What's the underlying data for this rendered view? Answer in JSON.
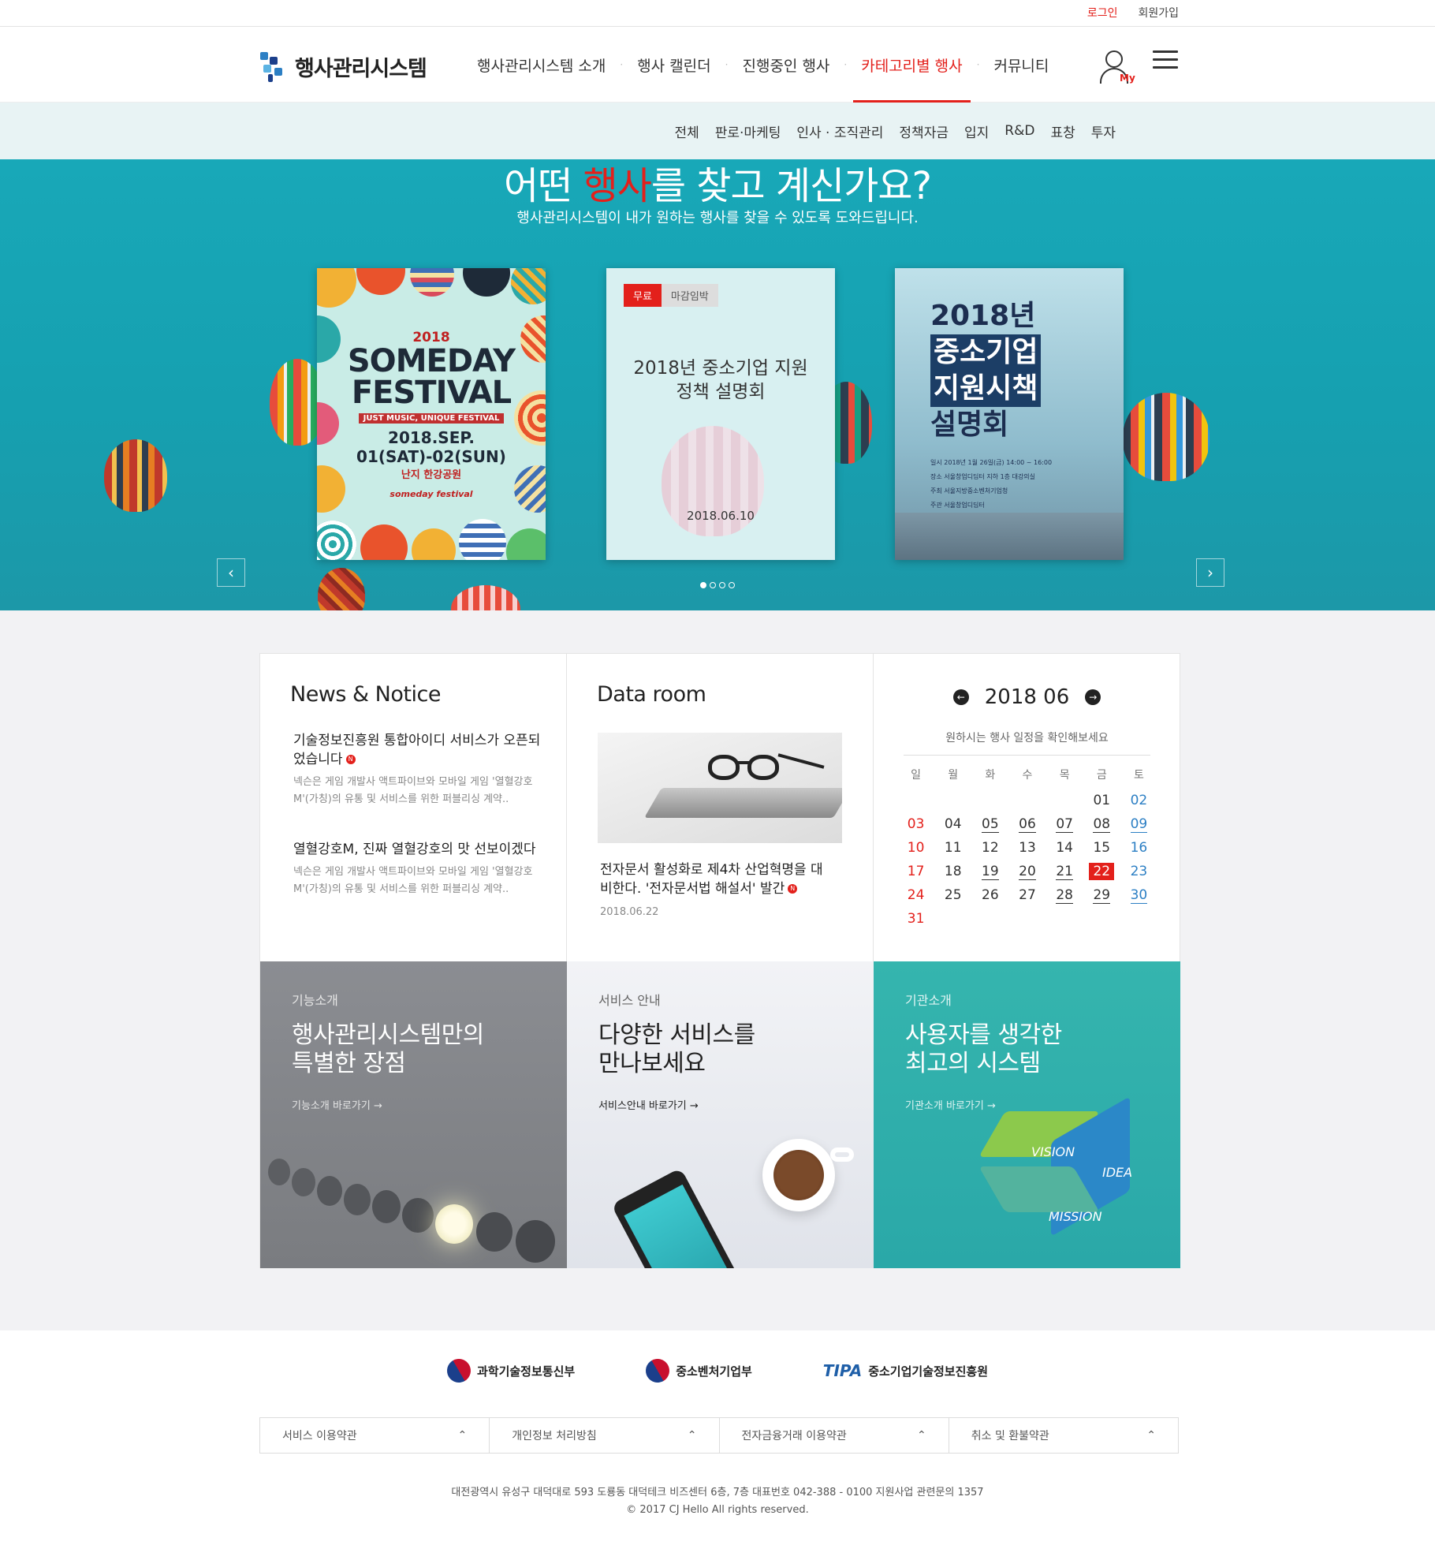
{
  "util": {
    "login": "로그인",
    "join": "회원가입"
  },
  "header": {
    "logo": "행사관리시스템",
    "nav": [
      "행사관리시스템 소개",
      "행사 캘린더",
      "진행중인 행사",
      "카테고리별 행사",
      "커뮤니티"
    ],
    "my_label": "My"
  },
  "subnav": [
    "전체",
    "판로·마케팅",
    "인사 · 조직관리",
    "정책자금",
    "입지",
    "R&D",
    "표창",
    "투자"
  ],
  "hero": {
    "title_pre": "어떤 ",
    "title_hl": "행사",
    "title_post": "를 찾고 계신가요?",
    "subtitle": "행사관리시스템이 내가 원하는 행사를 찾을 수 있도록 도와드립니다.",
    "card1": {
      "year": "2018",
      "line1": "SOMEDAY",
      "line2": "FESTIVAL",
      "tag": "JUST MUSIC, UNIQUE FESTIVAL",
      "date1": "2018.SEP.",
      "date2": "01(SAT)-02(SUN)",
      "place": "난지 한강공원",
      "brand": "someday festival"
    },
    "card2": {
      "badge_free": "무료",
      "badge_deadline": "마감임박",
      "title1": "2018년 중소기업 지원",
      "title2": "정책 설명회",
      "date": "2018.06.10"
    },
    "card3": {
      "l1": "2018년",
      "l2": "중소기업",
      "l3": "지원시책",
      "l4": "설명회",
      "info1": "일시  2018년 1월 26일(금) 14:00 ~ 16:00",
      "info2": "장소  서울창업디딤터 지하 1층 대강의실",
      "info3": "주최  서울지방중소벤처기업청",
      "info4": "주관  서울창업디딤터"
    },
    "prev": "‹",
    "next": "›"
  },
  "news": {
    "heading": "News & Notice",
    "items": [
      {
        "title": "기술정보진흥원 통합아이디 서비스가 오픈되었습니다",
        "new": "N",
        "desc": "넥슨은 게임 개발사 액트파이브와 모바일 게임 '열혈강호 M'(가칭)의 유통 및 서비스를 위한 퍼블리싱 계약.."
      },
      {
        "title": "열혈강호M, 진짜 열혈강호의 맛 선보이겠다",
        "desc": "넥슨은 게임 개발사 액트파이브와 모바일 게임 '열혈강호 M'(가칭)의 유통 및 서비스를 위한 퍼블리싱 계약.."
      }
    ]
  },
  "dataroom": {
    "heading": "Data room",
    "title": "전자문서 활성화로 제4차 산업혁명을 대비한다. '전자문서법 해설서' 발간",
    "new": "N",
    "date": "2018.06.22"
  },
  "calendar": {
    "month": "2018 06",
    "prev": "←",
    "next": "→",
    "guide": "원하시는 행사 일정을 확인해보세요",
    "weekdays": [
      "일",
      "월",
      "화",
      "수",
      "목",
      "금",
      "토"
    ],
    "weeks": [
      [
        "",
        "",
        "",
        "",
        "",
        "01",
        "02"
      ],
      [
        "03",
        "04",
        "05",
        "06",
        "07",
        "08",
        "09"
      ],
      [
        "10",
        "11",
        "12",
        "13",
        "14",
        "15",
        "16"
      ],
      [
        "17",
        "18",
        "19",
        "20",
        "21",
        "22",
        "23"
      ],
      [
        "24",
        "25",
        "26",
        "27",
        "28",
        "29",
        "30"
      ],
      [
        "31",
        "",
        "",
        "",
        "",
        "",
        ""
      ]
    ],
    "event_days": [
      "05",
      "06",
      "07",
      "08",
      "09",
      "19",
      "20",
      "21",
      "28",
      "29",
      "30"
    ],
    "today": "22"
  },
  "promos": [
    {
      "cat": "기능소개",
      "title1": "행사관리시스템만의",
      "title2": "특별한 장점",
      "link": "기능소개 바로가기  →"
    },
    {
      "cat": "서비스 안내",
      "title1": "다양한 서비스를",
      "title2": "만나보세요",
      "link": "서비스안내 바로가기  →"
    },
    {
      "cat": "기관소개",
      "title1": "사용자를 생각한",
      "title2": "최고의 시스템",
      "link": "기관소개 바로가기  →",
      "vision": "VISION",
      "idea": "IDEA",
      "mission": "MISSION"
    }
  ],
  "footer": {
    "orgs": [
      "과학기술정보통신부",
      "중소벤처기업부",
      "중소기업기술정보진흥원"
    ],
    "tipa": "TIPA",
    "terms": [
      "서비스 이용약관",
      "개인정보 처리방침",
      "전자금융거래 이용약관",
      "취소 및 환불약관"
    ],
    "address": "대전광역시 유성구 대덕대로 593 도룡동  대덕테크 비즈센터 6층, 7층  대표번호 042-388 - 0100  지원사업 관련문의 1357",
    "copyright": "© 2017 CJ Hello All rights reserved."
  },
  "colors": {
    "accent": "#e3201b",
    "hero": "#18a8b8",
    "teal": "#35b5ae",
    "saturday": "#2c7fc4"
  }
}
